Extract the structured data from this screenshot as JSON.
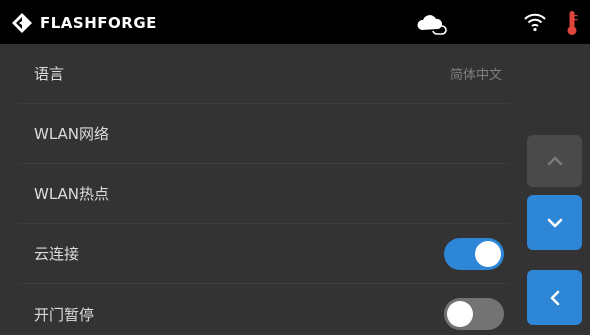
{
  "header": {
    "brand_name": "FLASHFORGE",
    "status_icons": [
      "cloud-link-icon",
      "wifi-icon",
      "thermometer-icon"
    ]
  },
  "settings": {
    "items": [
      {
        "label": "语言",
        "value": "简体中文"
      },
      {
        "label": "WLAN网络"
      },
      {
        "label": "WLAN热点"
      },
      {
        "label": "云连接",
        "toggle": true
      },
      {
        "label": "开门暂停",
        "toggle": false
      }
    ]
  },
  "nav": {
    "up_icon": "chevron-up-icon",
    "down_icon": "chevron-down-icon",
    "back_icon": "chevron-left-icon"
  },
  "colors": {
    "background": "#333333",
    "header": "#000000",
    "accent": "#2d86d6",
    "toggle_off": "#737373",
    "thermometer": "#e0463c"
  }
}
